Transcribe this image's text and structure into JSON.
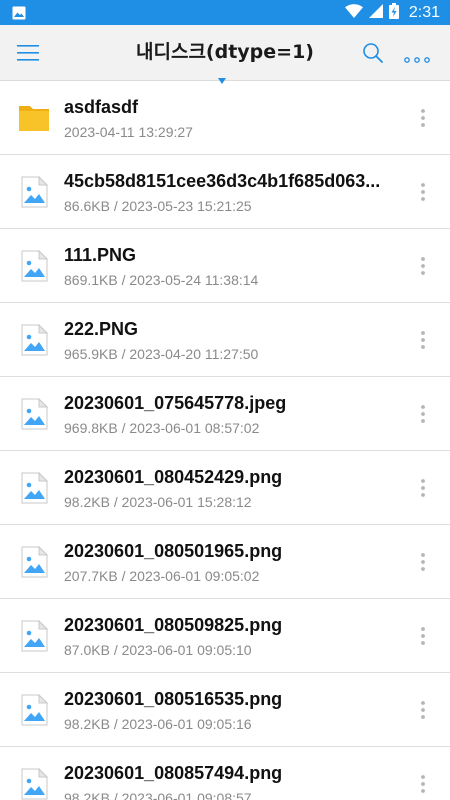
{
  "status_bar": {
    "time": "2:31"
  },
  "header": {
    "title": "내디스크(dtype=1)"
  },
  "colors": {
    "status_bar": "#1f8ee5",
    "accent": "#1f8ee5",
    "folder": "#f8c229",
    "image_icon": "#42a5f5"
  },
  "files": [
    {
      "type": "folder",
      "name": "asdfasdf",
      "meta": "2023-04-11 13:29:27"
    },
    {
      "type": "image",
      "name": "45cb58d8151cee36d3c4b1f685d063...",
      "meta": "86.6KB / 2023-05-23 15:21:25"
    },
    {
      "type": "image",
      "name": "111.PNG",
      "meta": "869.1KB / 2023-05-24 11:38:14"
    },
    {
      "type": "image",
      "name": "222.PNG",
      "meta": "965.9KB / 2023-04-20 11:27:50"
    },
    {
      "type": "image",
      "name": "20230601_075645778.jpeg",
      "meta": "969.8KB / 2023-06-01 08:57:02"
    },
    {
      "type": "image",
      "name": "20230601_080452429.png",
      "meta": "98.2KB / 2023-06-01 15:28:12"
    },
    {
      "type": "image",
      "name": "20230601_080501965.png",
      "meta": "207.7KB / 2023-06-01 09:05:02"
    },
    {
      "type": "image",
      "name": "20230601_080509825.png",
      "meta": "87.0KB / 2023-06-01 09:05:10"
    },
    {
      "type": "image",
      "name": "20230601_080516535.png",
      "meta": "98.2KB / 2023-06-01 09:05:16"
    },
    {
      "type": "image",
      "name": "20230601_080857494.png",
      "meta": "98.2KB / 2023-06-01 09:08:57"
    }
  ]
}
